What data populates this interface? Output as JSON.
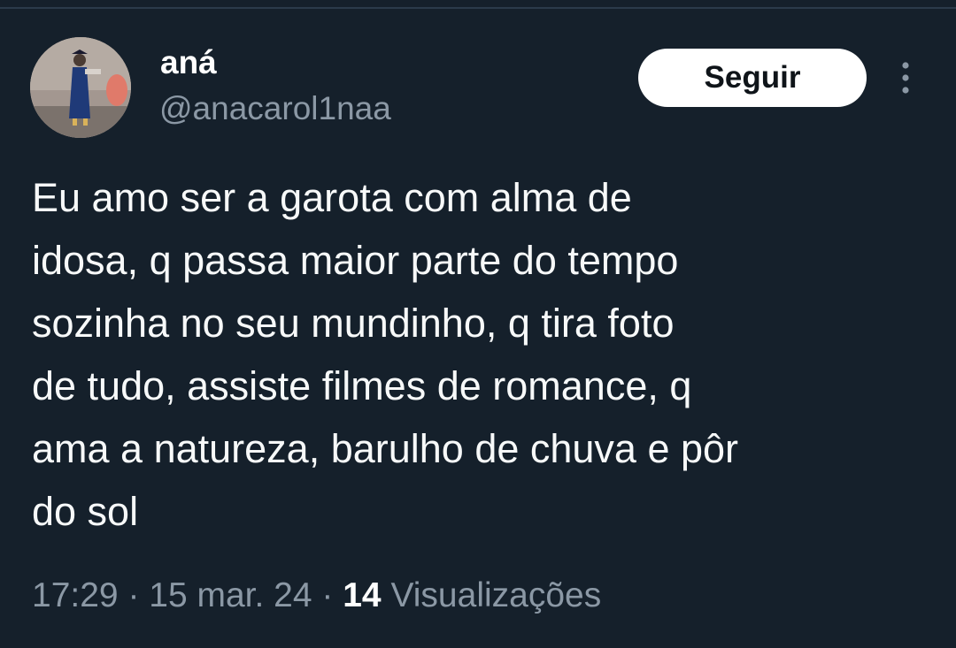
{
  "user": {
    "display_name": "aná",
    "handle": "@anacarol1naa",
    "avatar_icon": "profile-photo"
  },
  "actions": {
    "follow_label": "Seguir",
    "more_icon": "more-vertical-icon"
  },
  "tweet": {
    "text": "Eu amo ser a garota com alma de\nidosa, q passa maior parte do tempo\nsozinha no seu mundinho, q tira foto\nde tudo, assiste filmes de romance, q\nama a natureza, barulho de chuva e pôr\ndo sol"
  },
  "meta": {
    "time": "17:29",
    "separator": " · ",
    "date": "15 mar. 24",
    "views_count": "14",
    "views_label": " Visualizações"
  },
  "colors": {
    "background": "#15202b",
    "text_primary": "#f7f9f9",
    "text_secondary": "#8b98a5",
    "button_bg": "#ffffff",
    "button_text": "#0f1419"
  }
}
